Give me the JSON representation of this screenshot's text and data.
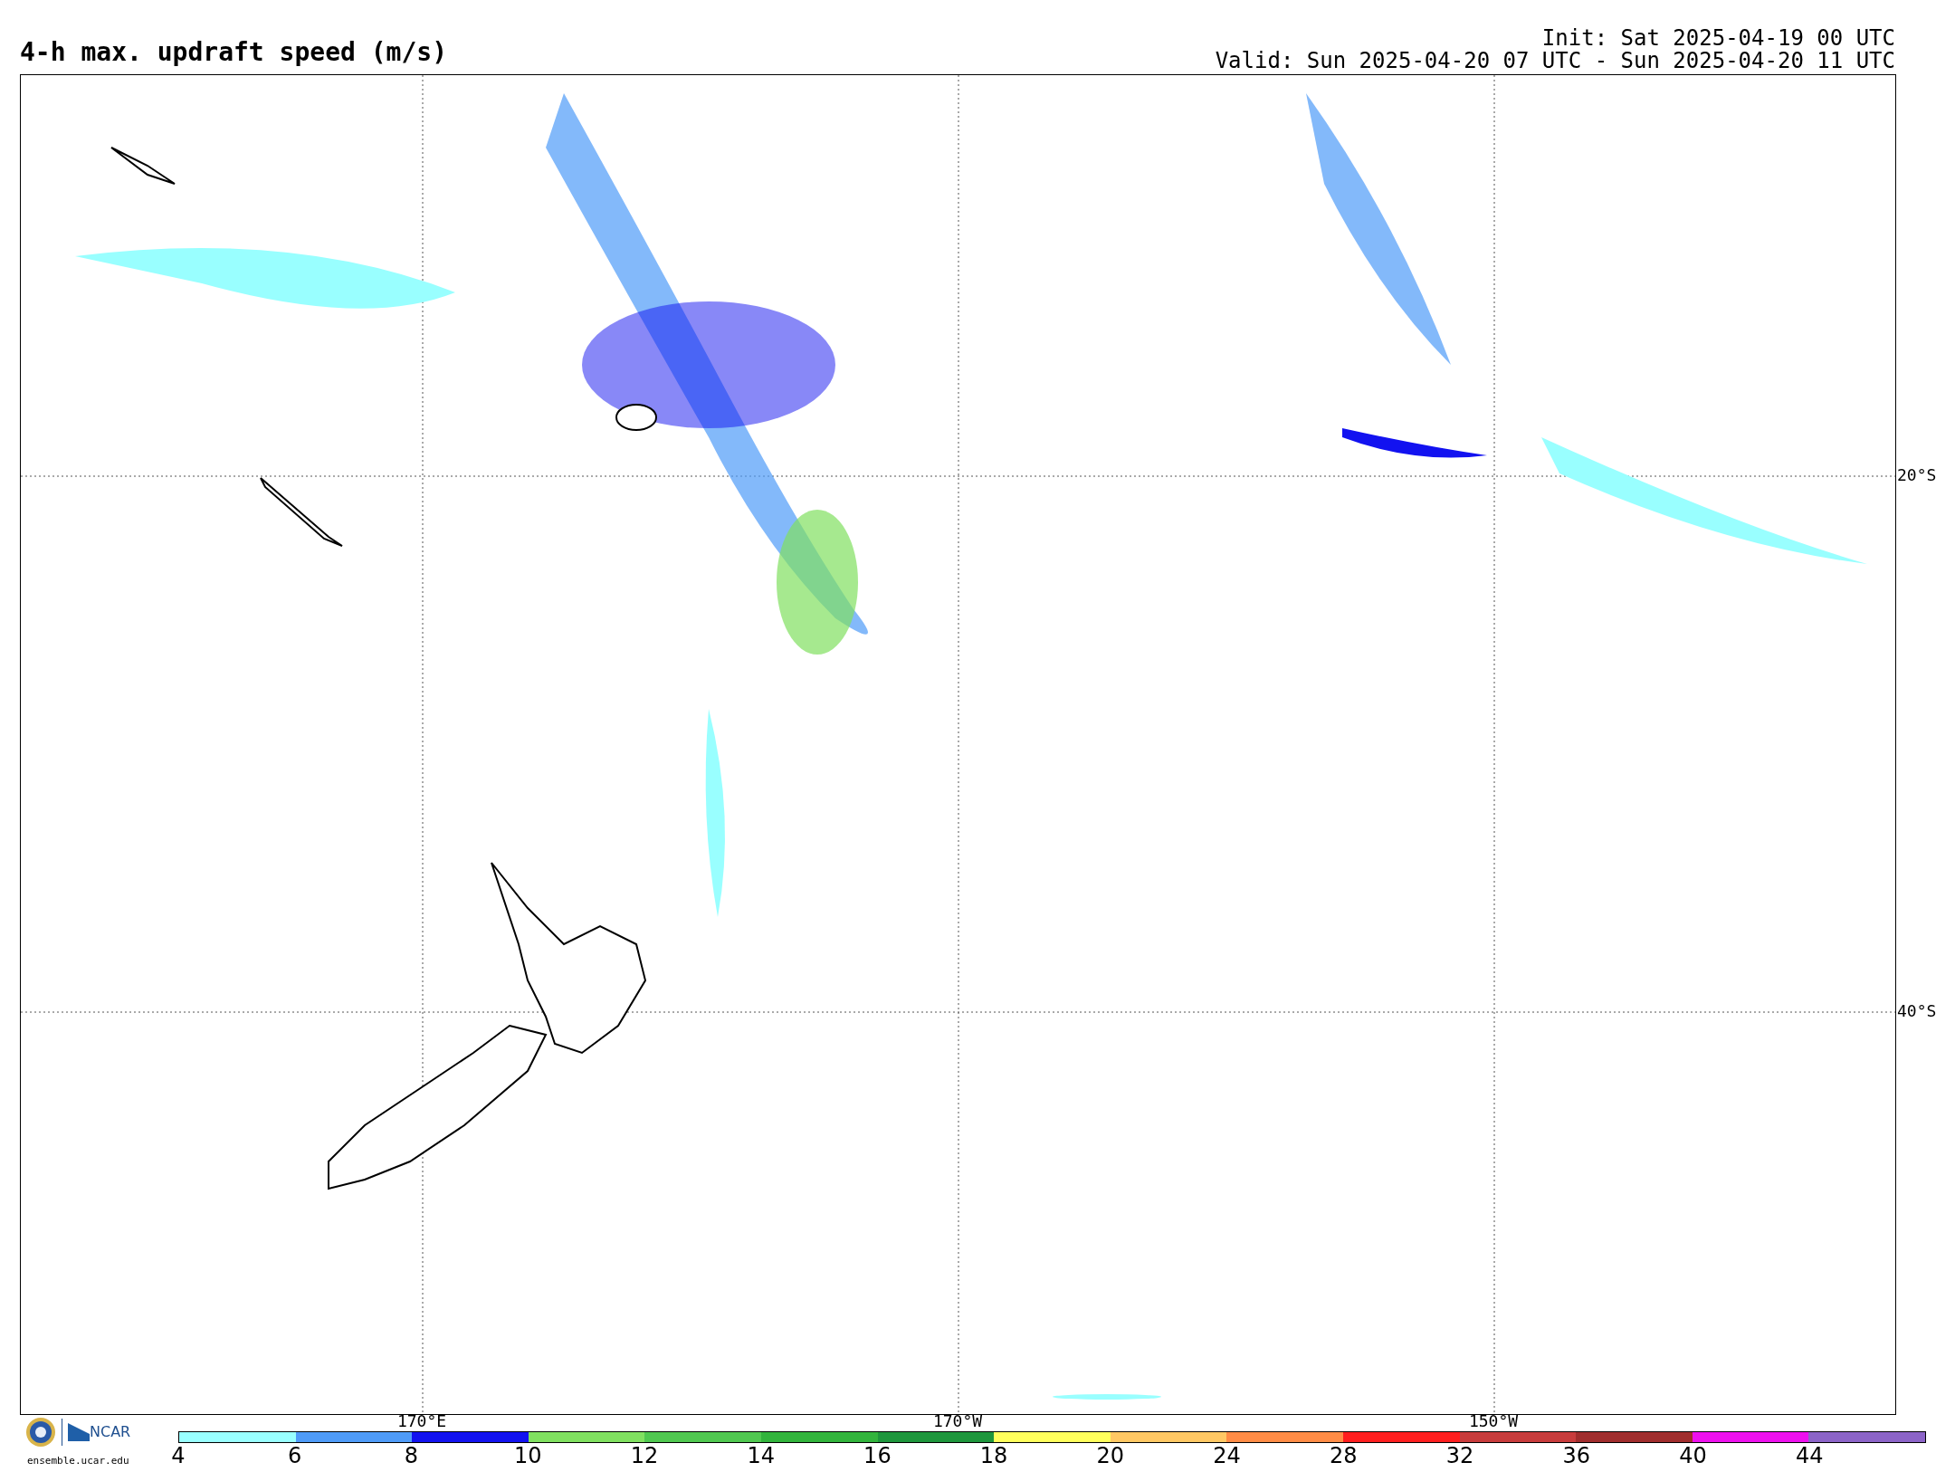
{
  "title": "4-h max. updraft speed (m/s)",
  "init": "Init: Sat 2025-04-19 00 UTC",
  "valid": "Valid: Sun 2025-04-20 07 UTC - Sun 2025-04-20 11 UTC",
  "map": {
    "longitudes": [
      "170°E",
      "170°W",
      "150°W"
    ],
    "latitudes": [
      "20°S",
      "40°S"
    ]
  },
  "branding": {
    "org": "NCAR",
    "site": "ensemble.ucar.edu"
  },
  "colorbar": [
    {
      "label": "4",
      "color": "#99ffff"
    },
    {
      "label": "6",
      "color": "#4f9bf8"
    },
    {
      "label": "8",
      "color": "#1212f0"
    },
    {
      "label": "10",
      "color": "#80e060"
    },
    {
      "label": "12",
      "color": "#50c850"
    },
    {
      "label": "14",
      "color": "#32b43c"
    },
    {
      "label": "16",
      "color": "#1e963c"
    },
    {
      "label": "18",
      "color": "#ffff5c"
    },
    {
      "label": "20",
      "color": "#ffc864"
    },
    {
      "label": "24",
      "color": "#ff8c46"
    },
    {
      "label": "28",
      "color": "#ff1e1e"
    },
    {
      "label": "32",
      "color": "#c83c3c"
    },
    {
      "label": "36",
      "color": "#a02d2d"
    },
    {
      "label": "40",
      "color": "#ee10ee"
    },
    {
      "label": "44",
      "color": "#8c64c8"
    }
  ]
}
